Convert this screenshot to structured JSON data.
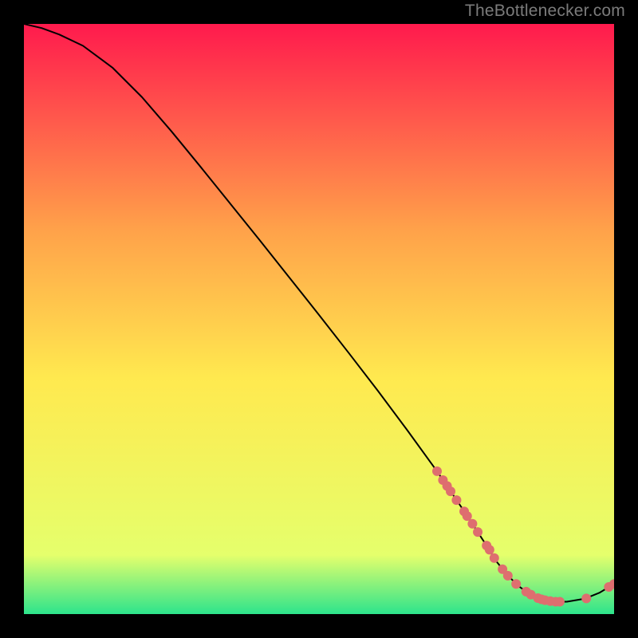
{
  "attribution": "TheBottlenecker.com",
  "chart_data": {
    "type": "line",
    "title": "",
    "xlabel": "",
    "ylabel": "",
    "xlim": [
      0,
      100
    ],
    "ylim": [
      0,
      100
    ],
    "grid": false,
    "legend": false,
    "background_gradient": {
      "top": "#ff1a4d",
      "upper_mid": "#ffa24a",
      "mid": "#ffe94f",
      "lower": "#e5ff6c",
      "base": "#2de48c"
    },
    "series": [
      {
        "name": "bottleneck-curve",
        "x": [
          0,
          3,
          6,
          10,
          15,
          20,
          25,
          30,
          35,
          40,
          45,
          50,
          55,
          60,
          65,
          70,
          74,
          76.5,
          78,
          80,
          82,
          84,
          86,
          88,
          90,
          92,
          95,
          97.5,
          100
        ],
        "y": [
          100,
          99.3,
          98.2,
          96.3,
          92.6,
          87.6,
          81.8,
          75.7,
          69.5,
          63.3,
          57.0,
          50.7,
          44.3,
          37.8,
          31.1,
          24.2,
          18.3,
          14.5,
          12.2,
          9.0,
          6.5,
          4.6,
          3.2,
          2.4,
          2.1,
          2.1,
          2.6,
          3.6,
          5.1
        ]
      }
    ],
    "markers": [
      {
        "x": 70.0,
        "y": 24.2
      },
      {
        "x": 71.0,
        "y": 22.7
      },
      {
        "x": 71.7,
        "y": 21.7
      },
      {
        "x": 72.3,
        "y": 20.8
      },
      {
        "x": 73.3,
        "y": 19.3
      },
      {
        "x": 74.6,
        "y": 17.4
      },
      {
        "x": 75.1,
        "y": 16.6
      },
      {
        "x": 76.0,
        "y": 15.3
      },
      {
        "x": 76.9,
        "y": 13.9
      },
      {
        "x": 78.4,
        "y": 11.6
      },
      {
        "x": 78.9,
        "y": 10.9
      },
      {
        "x": 79.7,
        "y": 9.5
      },
      {
        "x": 81.1,
        "y": 7.6
      },
      {
        "x": 82.0,
        "y": 6.5
      },
      {
        "x": 83.4,
        "y": 5.1
      },
      {
        "x": 85.1,
        "y": 3.8
      },
      {
        "x": 85.9,
        "y": 3.3
      },
      {
        "x": 87.1,
        "y": 2.7
      },
      {
        "x": 87.7,
        "y": 2.5
      },
      {
        "x": 88.3,
        "y": 2.35
      },
      {
        "x": 89.2,
        "y": 2.2
      },
      {
        "x": 90.1,
        "y": 2.1
      },
      {
        "x": 90.8,
        "y": 2.1
      },
      {
        "x": 95.3,
        "y": 2.65
      },
      {
        "x": 99.1,
        "y": 4.6
      },
      {
        "x": 100.0,
        "y": 5.1
      }
    ]
  }
}
